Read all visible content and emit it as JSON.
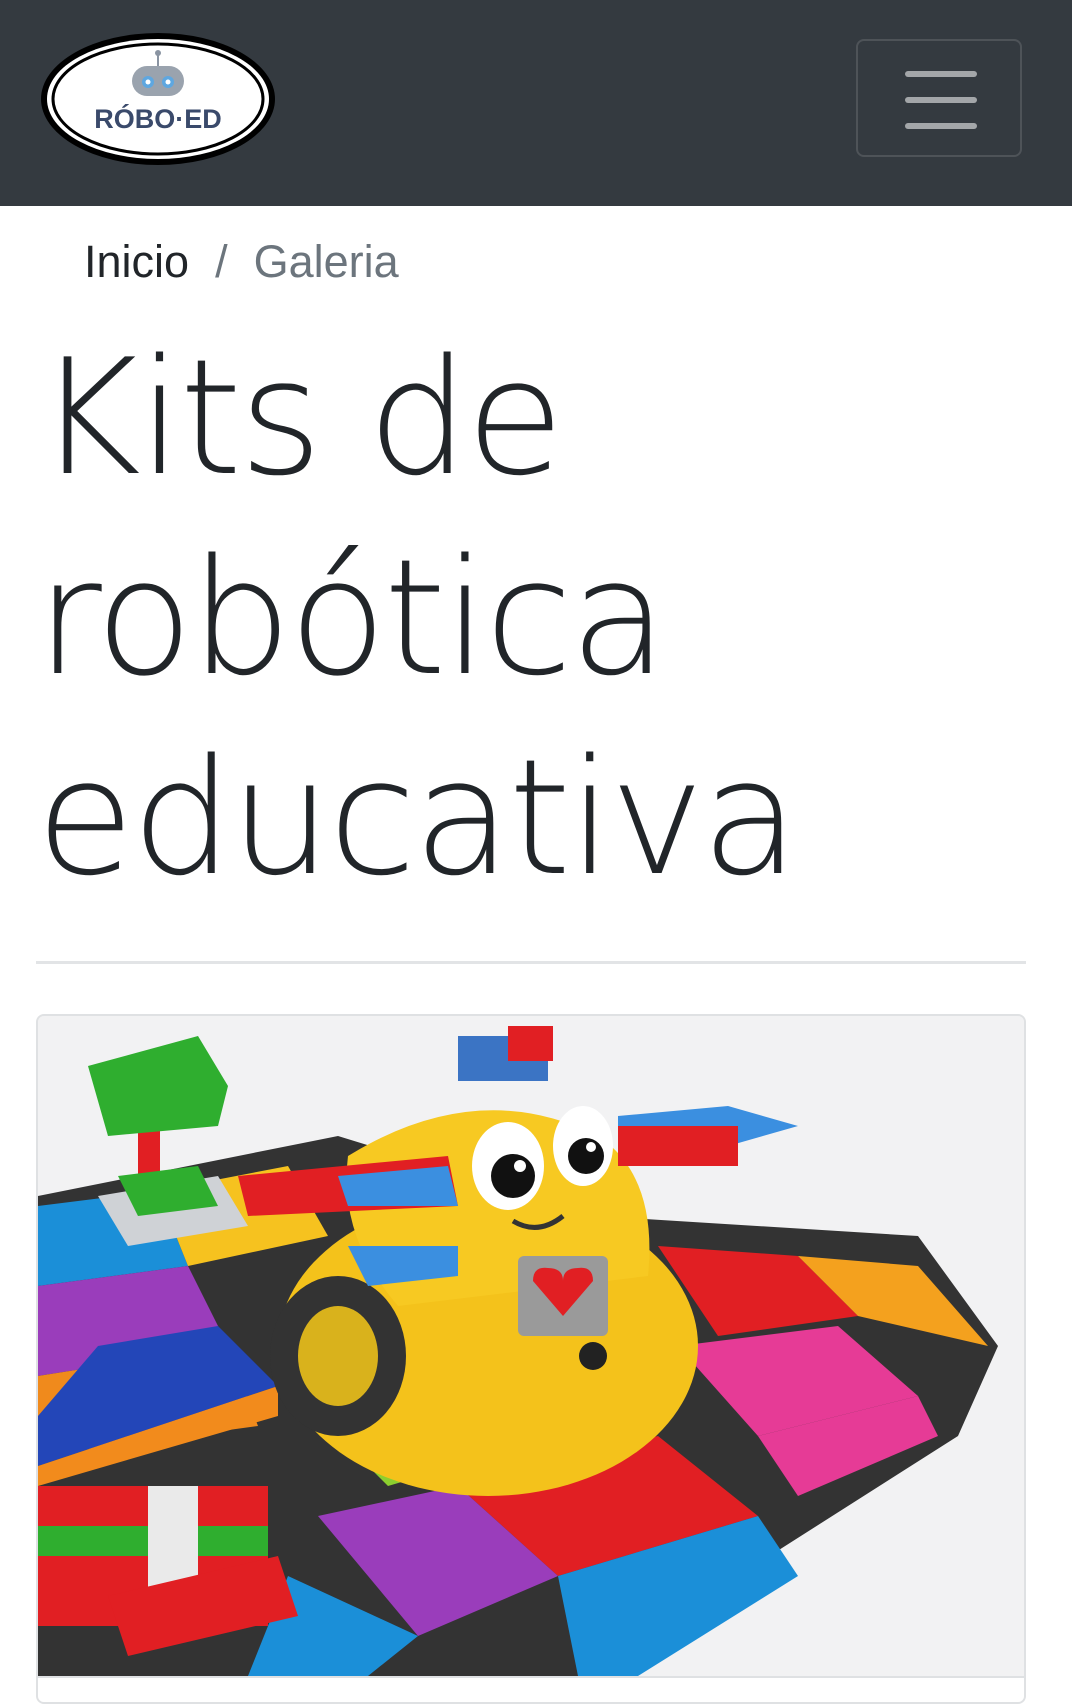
{
  "navbar": {
    "logo_text": "RÓBO·ED",
    "toggler_icon": "hamburger-menu-icon",
    "background": "#343a40"
  },
  "breadcrumb": {
    "home": "Inicio",
    "separator": "/",
    "current": "Galeria"
  },
  "page": {
    "title_lines": [
      "Kits de",
      "robótica",
      "educativa"
    ]
  },
  "gallery": {
    "items": [
      {
        "image": "yellow-robot-on-colorful-brick-mat"
      }
    ]
  }
}
